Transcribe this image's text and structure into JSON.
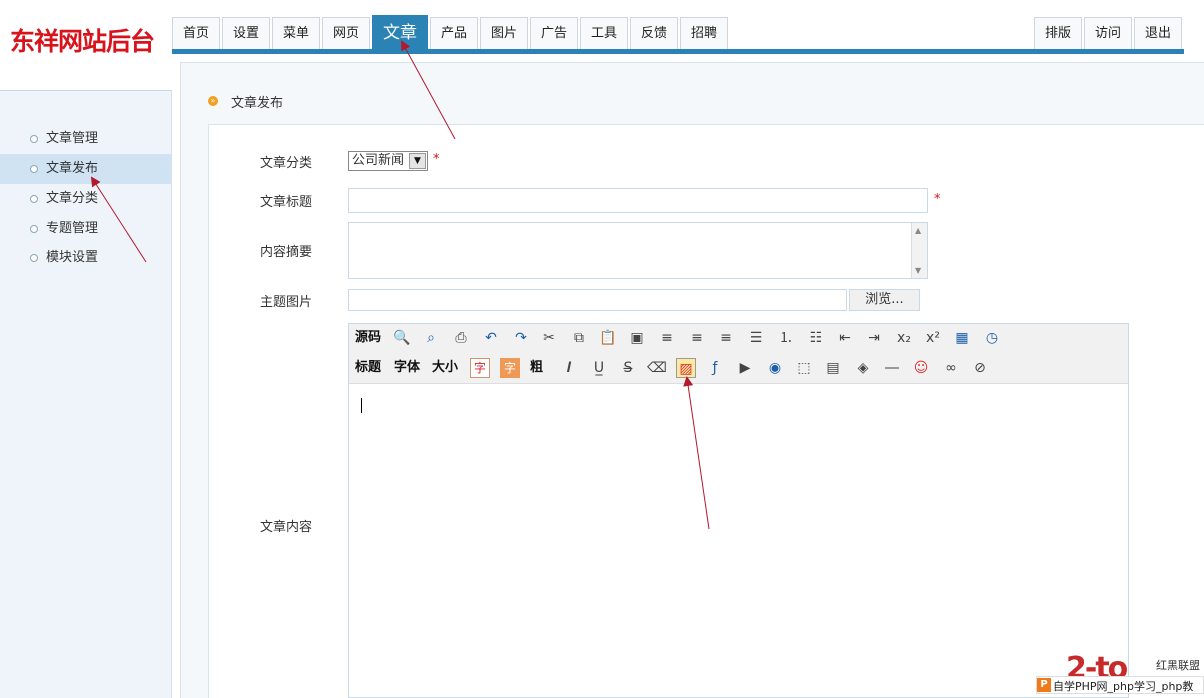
{
  "logo": {
    "text": "东祥网站后台"
  },
  "nav": {
    "tabs": [
      {
        "label": "首页"
      },
      {
        "label": "设置"
      },
      {
        "label": "菜单"
      },
      {
        "label": "网页"
      },
      {
        "label": "文章",
        "active": true
      },
      {
        "label": "产品"
      },
      {
        "label": "图片"
      },
      {
        "label": "广告"
      },
      {
        "label": "工具"
      },
      {
        "label": "反馈"
      },
      {
        "label": "招聘"
      }
    ],
    "right_tabs": [
      {
        "label": "排版"
      },
      {
        "label": "访问"
      },
      {
        "label": "退出"
      }
    ]
  },
  "sidebar": {
    "items": [
      {
        "label": "文章管理"
      },
      {
        "label": "文章发布",
        "active": true
      },
      {
        "label": "文章分类"
      },
      {
        "label": "专题管理"
      },
      {
        "label": "模块设置"
      }
    ]
  },
  "breadcrumb": {
    "text": "文章发布"
  },
  "form": {
    "category_label": "文章分类",
    "category_value": "公司新闻",
    "title_label": "文章标题",
    "title_value": "",
    "summary_label": "内容摘要",
    "summary_value": "",
    "image_label": "主题图片",
    "browse_label": "浏览...",
    "content_label": "文章内容",
    "required_mark": "*"
  },
  "editor": {
    "row1_text": [
      "源码"
    ],
    "row2_text": [
      "标题",
      "字体",
      "大小"
    ],
    "char_label": "字",
    "bold_label": "粗"
  },
  "watermark": {
    "logo": "2-to",
    "sub": "红黑联盟",
    "p_icon": "P",
    "bar_text": "自学PHP网_php学习_php教"
  },
  "colors": {
    "nav_accent": "#2a82b5",
    "logo_red": "#d9131b",
    "required_red": "#d0141b",
    "annotation_arrow": "#b3182b"
  }
}
